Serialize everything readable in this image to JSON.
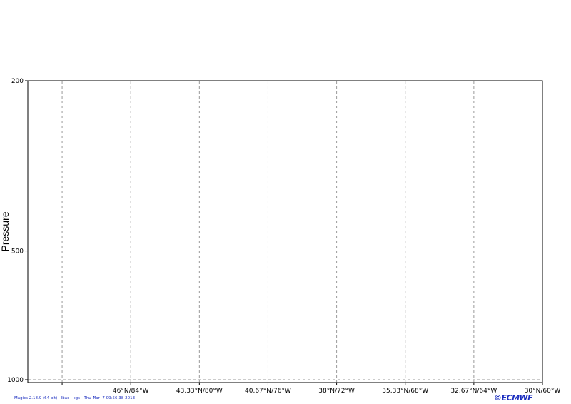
{
  "chart_data": {
    "type": "line",
    "title": "",
    "ylabel": "Pressure",
    "xlabel": "",
    "y_scale": "log",
    "y_inverted": true,
    "ylim": [
      200,
      1000
    ],
    "y_ticks": [
      200,
      500,
      1000
    ],
    "y_tick_labels": [
      "200",
      "500",
      "1000"
    ],
    "x_ticks": [
      {
        "index": 0,
        "label": ""
      },
      {
        "index": 1,
        "label": "46°N/84°W"
      },
      {
        "index": 2,
        "label": "43.33°N/80°W"
      },
      {
        "index": 3,
        "label": "40.67°N/76°W"
      },
      {
        "index": 4,
        "label": "38°N/72°W"
      },
      {
        "index": 5,
        "label": "35.33°N/68°W"
      },
      {
        "index": 6,
        "label": "32.67°N/64°W"
      },
      {
        "index": 7,
        "label": "30°N/60°W"
      }
    ],
    "x_range": [
      -0.5,
      7
    ],
    "grid": true,
    "series": []
  },
  "footer": {
    "text": "Magics 2.18.9 (64 bit) - lbac - cgs - Thu Mar  7 09:56:38 2013"
  },
  "logo": {
    "text": "©ECMWF"
  },
  "colors": {
    "axis": "#000000",
    "grid": "#9a9a9a",
    "footer": "#1a2dbf"
  }
}
